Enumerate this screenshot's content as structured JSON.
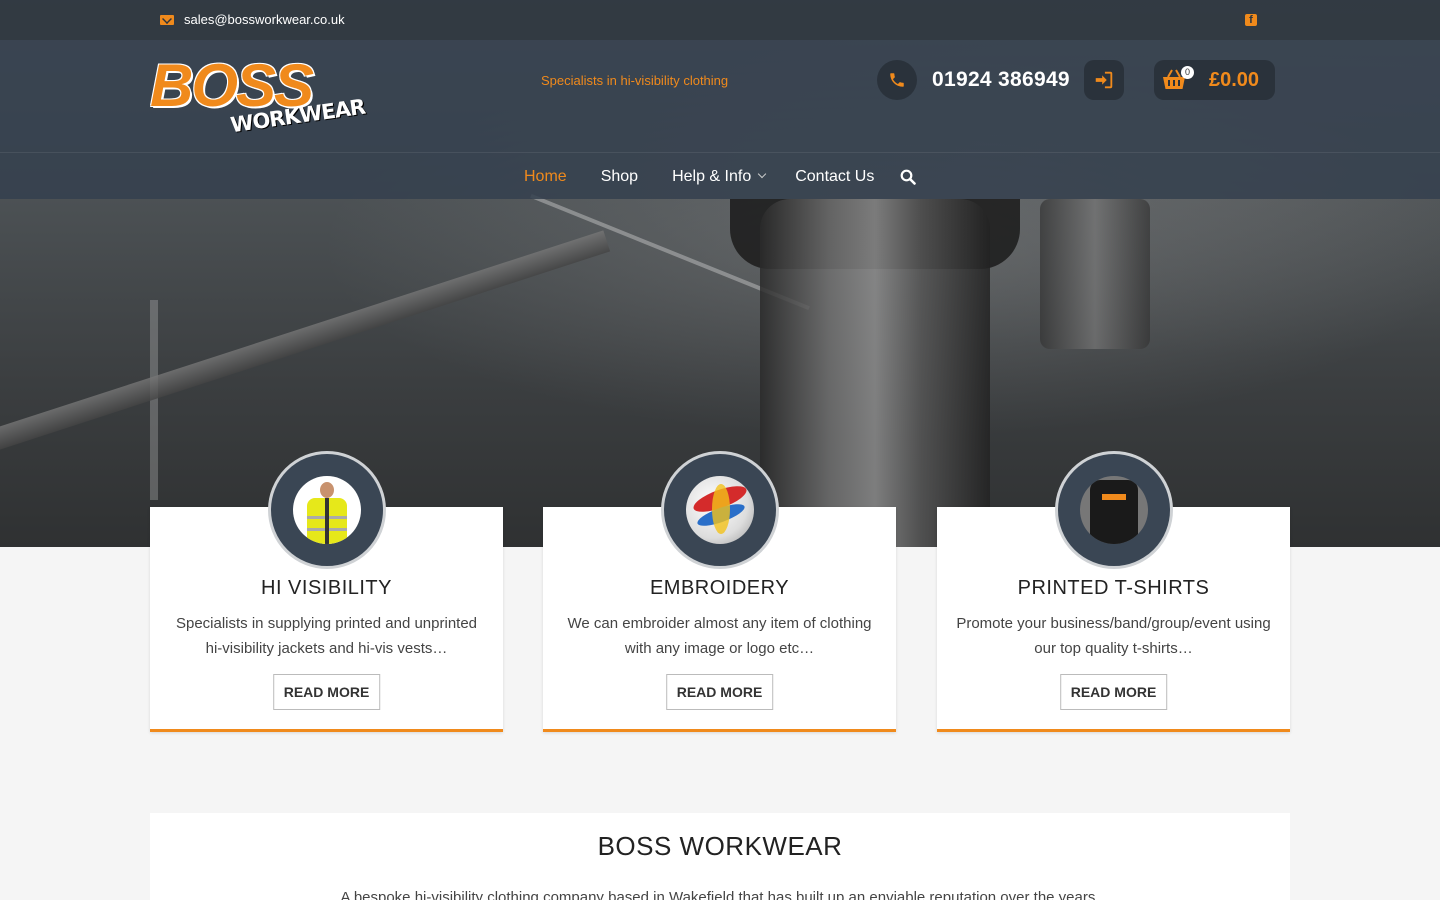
{
  "topbar": {
    "email": "sales@bossworkwear.co.uk"
  },
  "header": {
    "logo_main": "BOSS",
    "logo_sub": "WORKWEAR",
    "tagline": "Specialists in hi-visibility clothing",
    "phone": "01924 386949",
    "cart_count": "0",
    "cart_total": "£0.00"
  },
  "nav": {
    "items": [
      {
        "label": "Home",
        "active": true
      },
      {
        "label": "Shop"
      },
      {
        "label": "Help & Info",
        "has_dropdown": true
      },
      {
        "label": "Contact Us"
      }
    ]
  },
  "cards": [
    {
      "title": "HI VISIBILITY",
      "text": "Specialists in supplying printed and unprinted hi-visibility jackets and hi-vis vests…",
      "button": "READ MORE"
    },
    {
      "title": "EMBROIDERY",
      "text": "We can embroider almost any item of clothing with any image or logo etc…",
      "button": "READ MORE"
    },
    {
      "title": "PRINTED T-SHIRTS",
      "text": "Promote your business/band/group/event using our top quality t-shirts…",
      "button": "READ MORE"
    }
  ],
  "about": {
    "title": "BOSS WORKWEAR",
    "text": "A bespoke hi-visibility clothing company based in Wakefield that has built up an enviable reputation over the years."
  },
  "colors": {
    "accent": "#f08a1c",
    "header_bg": "#34404e",
    "dark_button": "#2a323b"
  },
  "icons": [
    "envelope-icon",
    "facebook-icon",
    "phone-icon",
    "sign-in-icon",
    "basket-icon",
    "search-icon",
    "chevron-down-icon"
  ]
}
